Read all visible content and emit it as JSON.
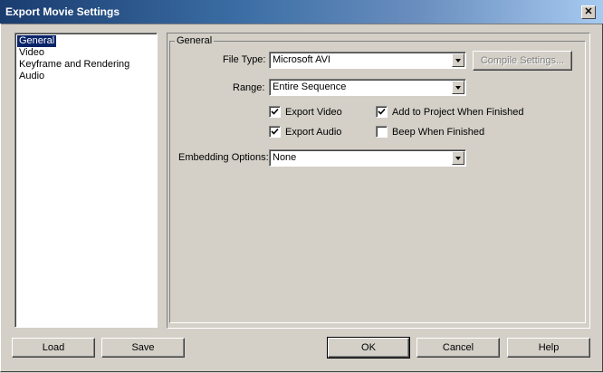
{
  "window": {
    "title": "Export Movie Settings",
    "close_glyph": "✕"
  },
  "categories": [
    {
      "label": "General",
      "selected": true
    },
    {
      "label": "Video",
      "selected": false
    },
    {
      "label": "Keyframe and Rendering",
      "selected": false
    },
    {
      "label": "Audio",
      "selected": false
    }
  ],
  "general": {
    "group_title": "General",
    "file_type": {
      "label": "File Type:",
      "value": "Microsoft AVI"
    },
    "compile_settings_label": "Compile Settings...",
    "range": {
      "label": "Range:",
      "value": "Entire Sequence"
    },
    "checkboxes": {
      "export_video": {
        "label": "Export Video",
        "checked": true
      },
      "add_to_project": {
        "label": "Add to Project When Finished",
        "checked": true
      },
      "export_audio": {
        "label": "Export Audio",
        "checked": true
      },
      "beep": {
        "label": "Beep When Finished",
        "checked": false
      }
    },
    "embedding": {
      "label": "Embedding Options:",
      "value": "None"
    }
  },
  "buttons": {
    "load": "Load",
    "save": "Save",
    "ok": "OK",
    "cancel": "Cancel",
    "help": "Help"
  }
}
